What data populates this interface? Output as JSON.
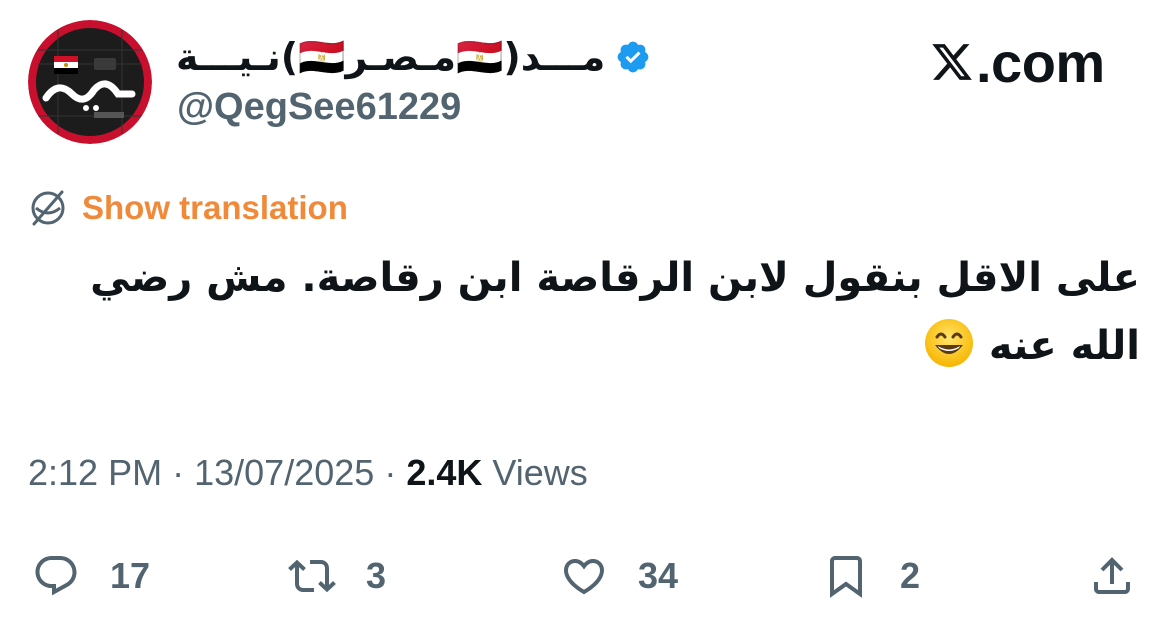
{
  "author": {
    "display_name": "مـــد(🇪🇬مـصـر🇪🇬)نـيـــة",
    "handle": "@QegSee61229",
    "verified": true,
    "avatar_text": "مدنية",
    "avatar_subtext": "MADANEYA"
  },
  "site_logo": "𝕏.com",
  "site_logo_text": ".com",
  "translation_link": "Show translation",
  "tweet": {
    "line1": "على الاقل بنقول لابن الرقاصة ابن رقاصة.  مش رضي",
    "line2": "الله عنه"
  },
  "meta": {
    "time": "2:12 PM",
    "separator": "·",
    "date": "13/07/2025",
    "views_count": "2.4K",
    "views_label": "Views"
  },
  "actions": {
    "replies": "17",
    "reposts": "3",
    "likes": "34",
    "bookmarks": "2"
  },
  "colors": {
    "text": "#0f1419",
    "secondary": "#536471",
    "link": "#f08a3a",
    "verified": "#1d9bf0"
  },
  "icons": [
    "verified-badge-icon",
    "x-logo-icon",
    "translate-globe-icon",
    "grinning-emoji-icon",
    "reply-icon",
    "repost-icon",
    "like-icon",
    "bookmark-icon",
    "share-icon"
  ]
}
